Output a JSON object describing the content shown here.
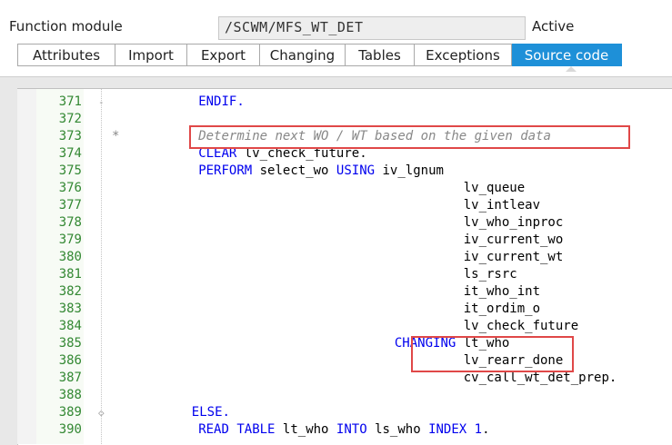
{
  "header": {
    "label": "Function module",
    "value": "/SCWM/MFS_WT_DET",
    "status": "Active"
  },
  "tabs": [
    {
      "label": "Attributes",
      "active": false
    },
    {
      "label": "Import",
      "active": false
    },
    {
      "label": "Export",
      "active": false
    },
    {
      "label": "Changing",
      "active": false
    },
    {
      "label": "Tables",
      "active": false
    },
    {
      "label": "Exceptions",
      "active": false
    },
    {
      "label": "Source code",
      "active": true
    }
  ],
  "colors": {
    "active_tab": "#1e90d8",
    "keyword": "#0000ee",
    "comment": "#888888",
    "line_number": "#338833",
    "highlight_box": "#e04848"
  },
  "code": {
    "lines": [
      {
        "no": "371",
        "marker": "-",
        "star": "",
        "indent": 26,
        "parts": [
          {
            "t": "ENDIF.",
            "c": "kw"
          }
        ]
      },
      {
        "no": "372",
        "marker": "",
        "star": "",
        "indent": 0,
        "parts": []
      },
      {
        "no": "373",
        "marker": "",
        "star": "*",
        "indent": 26,
        "parts": [
          {
            "t": "Determine next WO / WT based on the given data",
            "c": "cm"
          }
        ]
      },
      {
        "no": "374",
        "marker": "",
        "star": "",
        "indent": 26,
        "parts": [
          {
            "t": "CLEAR",
            "c": "kw"
          },
          {
            "t": " lv_check_future.",
            "c": ""
          }
        ]
      },
      {
        "no": "375",
        "marker": "",
        "star": "",
        "indent": 26,
        "parts": [
          {
            "t": "PERFORM",
            "c": "kw"
          },
          {
            "t": " select_wo ",
            "c": ""
          },
          {
            "t": "USING",
            "c": "kw"
          },
          {
            "t": " iv_lgnum",
            "c": ""
          }
        ]
      },
      {
        "no": "376",
        "marker": "",
        "star": "",
        "indent": 0,
        "parts": [
          {
            "t": "                                              lv_queue",
            "c": ""
          }
        ]
      },
      {
        "no": "377",
        "marker": "",
        "star": "",
        "indent": 0,
        "parts": [
          {
            "t": "                                              lv_intleav",
            "c": ""
          }
        ]
      },
      {
        "no": "378",
        "marker": "",
        "star": "",
        "indent": 0,
        "parts": [
          {
            "t": "                                              lv_who_inproc",
            "c": ""
          }
        ]
      },
      {
        "no": "379",
        "marker": "",
        "star": "",
        "indent": 0,
        "parts": [
          {
            "t": "                                              iv_current_wo",
            "c": ""
          }
        ]
      },
      {
        "no": "380",
        "marker": "",
        "star": "",
        "indent": 0,
        "parts": [
          {
            "t": "                                              iv_current_wt",
            "c": ""
          }
        ]
      },
      {
        "no": "381",
        "marker": "",
        "star": "",
        "indent": 0,
        "parts": [
          {
            "t": "                                              ls_rsrc",
            "c": ""
          }
        ]
      },
      {
        "no": "382",
        "marker": "",
        "star": "",
        "indent": 0,
        "parts": [
          {
            "t": "                                              it_who_int",
            "c": ""
          }
        ]
      },
      {
        "no": "383",
        "marker": "",
        "star": "",
        "indent": 0,
        "parts": [
          {
            "t": "                                              it_ordim_o",
            "c": ""
          }
        ]
      },
      {
        "no": "384",
        "marker": "",
        "star": "",
        "indent": 0,
        "parts": [
          {
            "t": "                                              lv_check_future",
            "c": ""
          }
        ]
      },
      {
        "no": "385",
        "marker": "",
        "star": "",
        "indent": 0,
        "parts": [
          {
            "t": "                                     ",
            "c": ""
          },
          {
            "t": "CHANGING",
            "c": "kw"
          },
          {
            "t": " lt_who",
            "c": ""
          }
        ]
      },
      {
        "no": "386",
        "marker": "",
        "star": "",
        "indent": 0,
        "parts": [
          {
            "t": "                                              lv_rearr_done",
            "c": ""
          }
        ]
      },
      {
        "no": "387",
        "marker": "",
        "star": "",
        "indent": 0,
        "parts": [
          {
            "t": "                                              cv_call_wt_det_prep.",
            "c": ""
          }
        ]
      },
      {
        "no": "388",
        "marker": "",
        "star": "",
        "indent": 0,
        "parts": []
      },
      {
        "no": "389",
        "marker": "◇",
        "star": "",
        "indent": 24,
        "parts": [
          {
            "t": "ELSE.",
            "c": "kw"
          }
        ]
      },
      {
        "no": "390",
        "marker": "",
        "star": "",
        "indent": 26,
        "parts": [
          {
            "t": "READ TABLE",
            "c": "kw"
          },
          {
            "t": " lt_who ",
            "c": ""
          },
          {
            "t": "INTO",
            "c": "kw"
          },
          {
            "t": " ls_who ",
            "c": ""
          },
          {
            "t": "INDEX",
            "c": "kw"
          },
          {
            "t": " ",
            "c": ""
          },
          {
            "t": "1",
            "c": "num"
          },
          {
            "t": ".",
            "c": ""
          }
        ]
      }
    ]
  }
}
